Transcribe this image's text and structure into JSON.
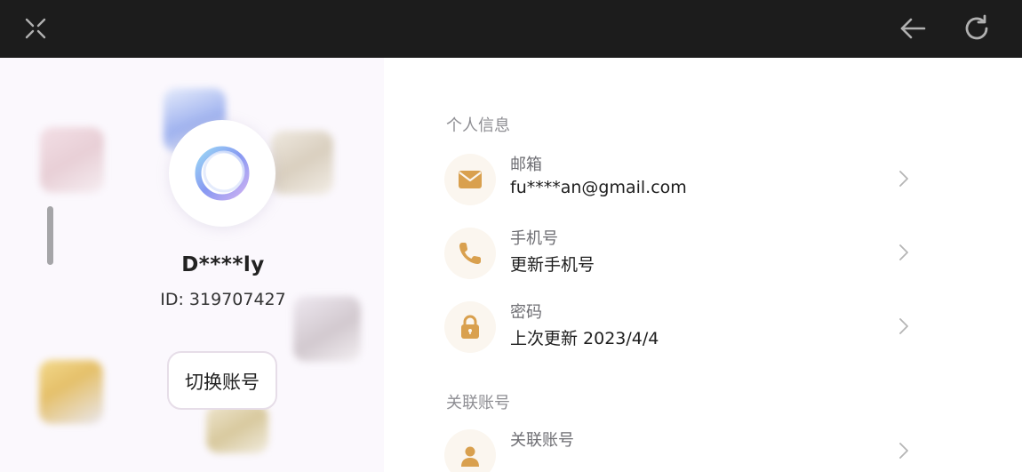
{
  "topbar": {
    "close_icon": "close-icon",
    "back_icon": "arrow-left-icon",
    "refresh_icon": "refresh-icon"
  },
  "profile": {
    "username": "D****ly",
    "id_text": "ID: 319707427",
    "switch_label": "切换账号"
  },
  "personal_info": {
    "title": "个人信息",
    "items": [
      {
        "label": "邮箱",
        "value": "fu****an@gmail.com",
        "icon": "mail-icon"
      },
      {
        "label": "手机号",
        "value": "更新手机号",
        "icon": "phone-icon"
      },
      {
        "label": "密码",
        "value": "上次更新 2023/4/4",
        "icon": "lock-icon"
      }
    ]
  },
  "linked_accounts": {
    "title": "关联账号",
    "items": [
      {
        "label": "关联账号",
        "icon": "user-icon"
      }
    ]
  },
  "colors": {
    "topbar_bg": "#1c1c1c",
    "icon_accent": "#d9a04e",
    "chevron": "#b5b5b5"
  }
}
